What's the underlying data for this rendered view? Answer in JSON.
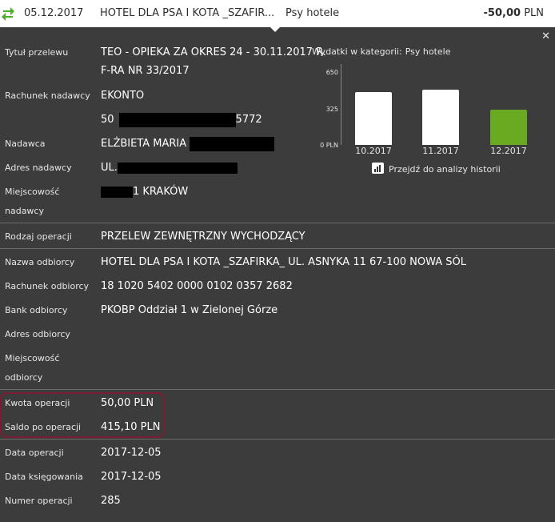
{
  "transaction": {
    "date": "05.12.2017",
    "name": "HOTEL DLA PSA I KOTA _SZAFIR...",
    "category": "Psy hotele",
    "amount_value": "-50,00",
    "amount_currency": "PLN",
    "icon": "transfer-arrows-icon"
  },
  "close_label": "✕",
  "details": {
    "title_label": "Tytuł przelewu",
    "title_line1": "TEO - OPIEKA ZA OKRES 24 - 30.11.2017 R.",
    "title_line2": "F-RA NR 33/2017",
    "sender_account_label": "Rachunek nadawcy",
    "sender_account_name": "EKONTO",
    "sender_account_prefix": "50",
    "sender_account_suffix": "5772",
    "sender_label": "Nadawca",
    "sender_value": "ELŻBIETA MARIA",
    "sender_address_label": "Adres nadawcy",
    "sender_address_value": "UL.",
    "sender_city_label_1": "Miejscowość",
    "sender_city_label_2": "nadawcy",
    "sender_city_value": "1 KRAKÓW",
    "operation_type_label": "Rodzaj operacji",
    "operation_type_value": "PRZELEW ZEWNĘTRZNY WYCHODZĄCY",
    "recipient_name_label": "Nazwa odbiorcy",
    "recipient_name_value": "HOTEL DLA PSA I KOTA _SZAFIRKA_ UL. ASNYKA 11 67-100 NOWA SÓL",
    "recipient_account_label": "Rachunek odbiorcy",
    "recipient_account_value": "18 1020 5402 0000 0102 0357 2682",
    "recipient_bank_label": "Bank odbiorcy",
    "recipient_bank_value": "PKOBP Oddział 1 w Zielonej Górze",
    "recipient_address_label": "Adres odbiorcy",
    "recipient_city_label_1": "Miejscowość",
    "recipient_city_label_2": "odbiorcy",
    "amount_label": "Kwota operacji",
    "amount_value": "50,00 PLN",
    "balance_label": "Saldo po operacji",
    "balance_value": "415,10 PLN",
    "operation_date_label": "Data operacji",
    "operation_date_value": "2017-12-05",
    "booking_date_label": "Data księgowania",
    "booking_date_value": "2017-12-05",
    "operation_number_label": "Numer operacji",
    "operation_number_value": "285"
  },
  "chart_data": {
    "type": "bar",
    "title": "Wydatki w kategorii:",
    "category_name": "Psy hotele",
    "categories": [
      "10.2017",
      "11.2017",
      "12.2017"
    ],
    "values": [
      521,
      546,
      350
    ],
    "y_ticks": [
      "650",
      "325",
      "0 PLN"
    ],
    "ylim": [
      0,
      650
    ],
    "bar_colors": [
      "#ffffff",
      "#ffffff",
      "#6aaa22"
    ],
    "grid": false
  },
  "history_link": "Przejdź do analizy historii",
  "colors": {
    "background": "#3c3c3c",
    "highlight_border": "#7a1c33",
    "accent_green": "#6aaa22"
  }
}
